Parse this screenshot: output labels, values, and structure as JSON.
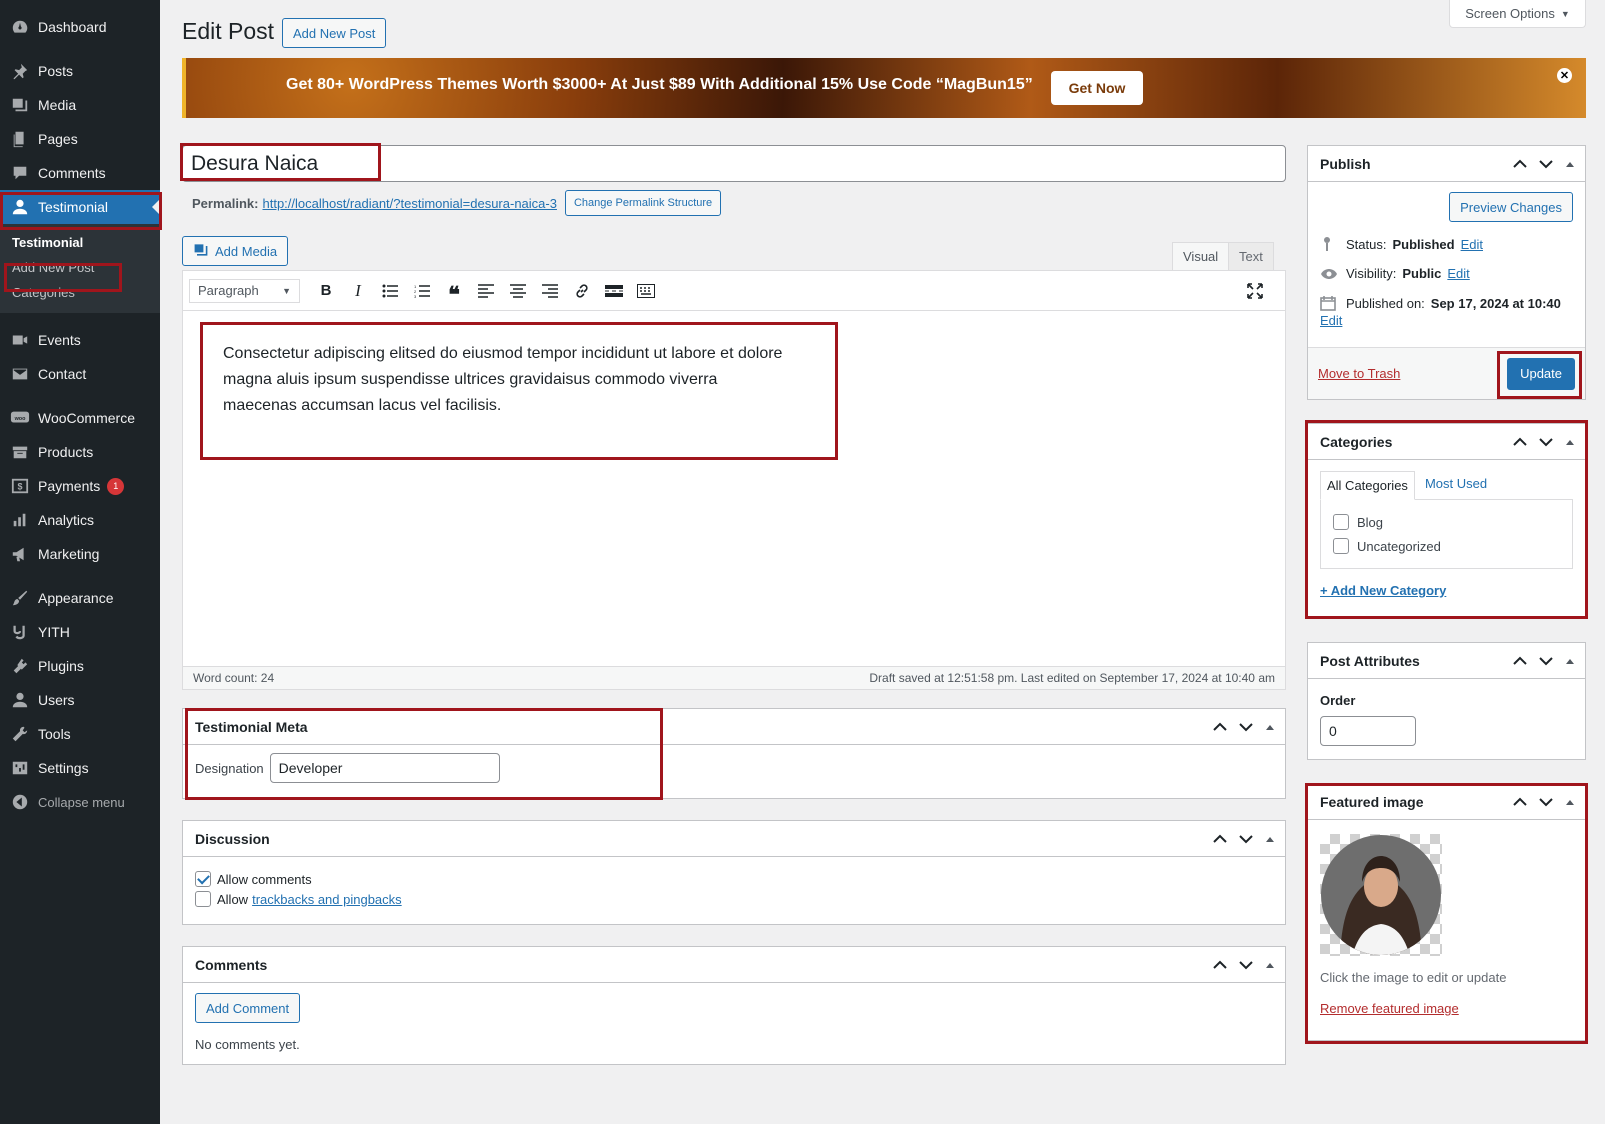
{
  "sidebar": {
    "items": [
      {
        "label": "Dashboard",
        "icon": "dashboard-icon"
      },
      {
        "label": "Posts",
        "icon": "pin-icon"
      },
      {
        "label": "Media",
        "icon": "media-icon"
      },
      {
        "label": "Pages",
        "icon": "pages-icon"
      },
      {
        "label": "Comments",
        "icon": "comments-icon"
      },
      {
        "label": "Testimonial",
        "icon": "user-icon"
      },
      {
        "label": "Events",
        "icon": "camera-icon"
      },
      {
        "label": "Contact",
        "icon": "mail-icon"
      },
      {
        "label": "WooCommerce",
        "icon": "woo-icon"
      },
      {
        "label": "Products",
        "icon": "archive-icon"
      },
      {
        "label": "Payments",
        "icon": "dollar-icon",
        "badge": "1"
      },
      {
        "label": "Analytics",
        "icon": "bar-chart-icon"
      },
      {
        "label": "Marketing",
        "icon": "megaphone-icon"
      },
      {
        "label": "Appearance",
        "icon": "brush-icon"
      },
      {
        "label": "YITH",
        "icon": "yith-icon"
      },
      {
        "label": "Plugins",
        "icon": "plugin-icon"
      },
      {
        "label": "Users",
        "icon": "users-icon"
      },
      {
        "label": "Tools",
        "icon": "wrench-icon"
      },
      {
        "label": "Settings",
        "icon": "settings-icon"
      }
    ],
    "submenu": [
      "Testimonial",
      "Add New Post",
      "Categories"
    ],
    "collapse_label": "Collapse menu"
  },
  "header": {
    "screen_options": "Screen Options",
    "title": "Edit Post",
    "add_new": "Add New Post"
  },
  "banner": {
    "text": "Get 80+ WordPress Themes Worth $3000+ At Just $89 With Additional 15% Use Code “MagBun15”",
    "cta": "Get Now"
  },
  "post": {
    "title": "Desura Naica",
    "permalink_label": "Permalink:",
    "permalink_url": "http://localhost/radiant/?testimonial=desura-naica-3",
    "change_permalink": "Change Permalink Structure",
    "content": "Consectetur adipiscing elitsed do eiusmod tempor incididunt ut labore et dolore magna aluis ipsum suspendisse ultrices gravidaisus commodo viverra maecenas accumsan lacus vel facilisis."
  },
  "editor": {
    "add_media": "Add Media",
    "tab_visual": "Visual",
    "tab_text": "Text",
    "format": "Paragraph",
    "word_count": "Word count: 24",
    "draft_saved": "Draft saved at 12:51:58 pm. Last edited on September 17, 2024 at 10:40 am"
  },
  "testimonial_meta": {
    "title": "Testimonial Meta",
    "designation_label": "Designation",
    "designation_value": "Developer"
  },
  "discussion": {
    "title": "Discussion",
    "allow_comments": "Allow comments",
    "allow_prefix": "Allow",
    "trackbacks_link": "trackbacks and pingbacks"
  },
  "comments": {
    "title": "Comments",
    "add_comment": "Add Comment",
    "empty": "No comments yet."
  },
  "publish": {
    "title": "Publish",
    "preview": "Preview Changes",
    "status_label": "Status:",
    "status_value": "Published",
    "visibility_label": "Visibility:",
    "visibility_value": "Public",
    "published_label": "Published on:",
    "published_value": "Sep 17, 2024 at 10:40",
    "edit": "Edit",
    "trash": "Move to Trash",
    "update": "Update"
  },
  "categories": {
    "title": "Categories",
    "tab_all": "All Categories",
    "tab_most_used": "Most Used",
    "items": [
      "Blog",
      "Uncategorized"
    ],
    "add_new": "+ Add New Category"
  },
  "post_attributes": {
    "title": "Post Attributes",
    "order_label": "Order",
    "order_value": "0"
  },
  "featured_image": {
    "title": "Featured image",
    "hint": "Click the image to edit or update",
    "remove": "Remove featured image"
  }
}
